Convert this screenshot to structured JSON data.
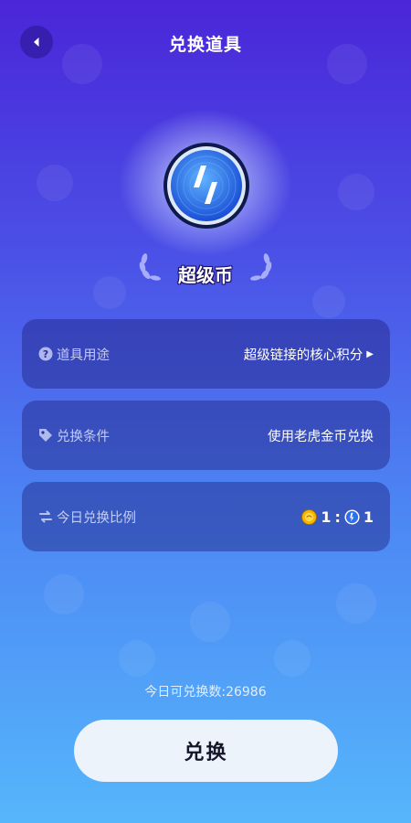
{
  "header": {
    "title": "兑换道具",
    "back_icon": "chevron-left-icon"
  },
  "item": {
    "name": "超级币",
    "icon": "lightning-coin-icon"
  },
  "rows": [
    {
      "icon": "question-circle-icon",
      "label": "道具用途",
      "value": "超级链接的核心积分",
      "has_arrow": true
    },
    {
      "icon": "tag-icon",
      "label": "兑换条件",
      "value": "使用老虎金币兑换",
      "has_arrow": false
    },
    {
      "icon": "swap-icon",
      "label": "今日兑换比例",
      "ratio_left": "1",
      "ratio_sep": ":",
      "ratio_right": "1"
    }
  ],
  "footer": {
    "daily_label": "今日可兑换数:26986",
    "button_label": "兑换"
  },
  "colors": {
    "gradient_top": "#4a26d8",
    "gradient_bottom": "#56b6fb",
    "card_bg": "rgba(28,26,120,0.42)",
    "button_bg": "#edf3fb"
  }
}
